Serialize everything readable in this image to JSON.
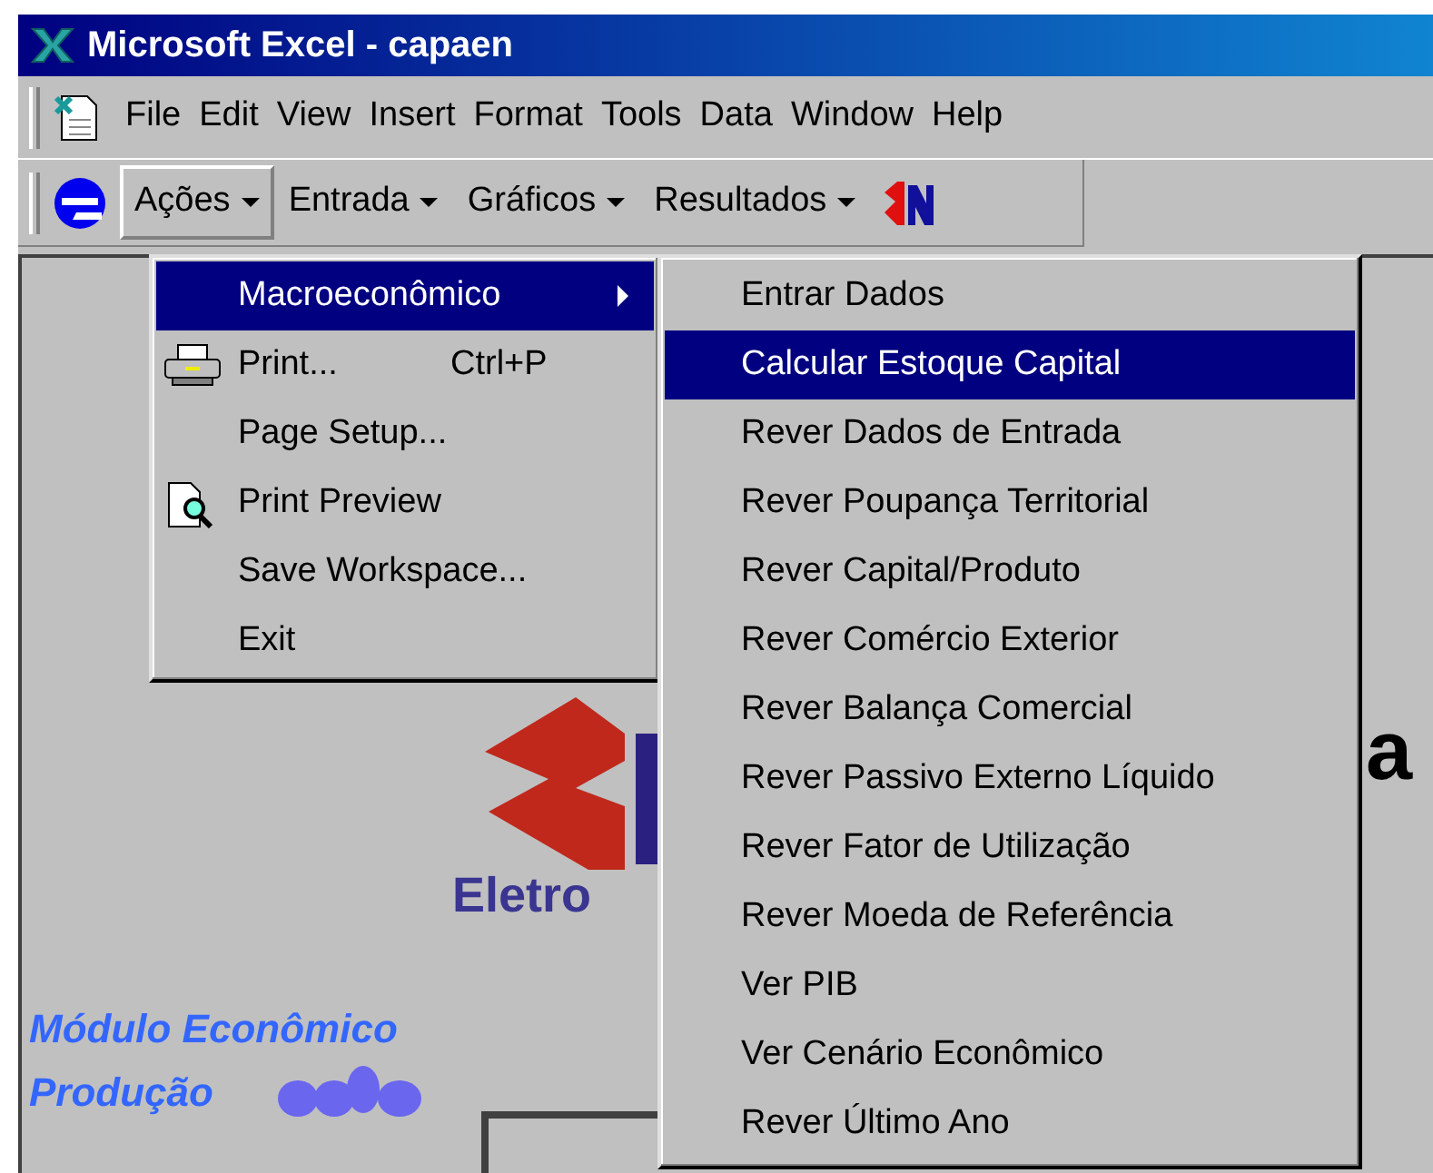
{
  "window": {
    "title": "Microsoft Excel - capaen"
  },
  "menu_bar": [
    {
      "label": "File"
    },
    {
      "label": "Edit"
    },
    {
      "label": "View"
    },
    {
      "label": "Insert"
    },
    {
      "label": "Format"
    },
    {
      "label": "Tools"
    },
    {
      "label": "Data"
    },
    {
      "label": "Window"
    },
    {
      "label": "Help"
    }
  ],
  "toolbar": [
    {
      "label": "Ações",
      "selected": true
    },
    {
      "label": "Entrada",
      "selected": false
    },
    {
      "label": "Gráficos",
      "selected": false
    },
    {
      "label": "Resultados",
      "selected": false
    }
  ],
  "menu": {
    "items": [
      {
        "kind": "submenu",
        "label": "Macroeconômico",
        "selected": true
      },
      {
        "kind": "print",
        "label": "Print...",
        "shortcut": "Ctrl+P",
        "selected": false
      },
      {
        "kind": "command",
        "label": "Page Setup...",
        "selected": false
      },
      {
        "kind": "preview",
        "label": "Print Preview",
        "selected": false
      },
      {
        "kind": "command",
        "label": "Save Workspace...",
        "selected": false
      },
      {
        "kind": "command",
        "label": "Exit",
        "selected": false
      }
    ]
  },
  "submenu": {
    "items": [
      {
        "label": "Entrar Dados",
        "selected": false
      },
      {
        "label": "Calcular Estoque Capital",
        "selected": true
      },
      {
        "label": "Rever Dados de Entrada",
        "selected": false
      },
      {
        "label": "Rever Poupança Territorial",
        "selected": false
      },
      {
        "label": "Rever Capital/Produto",
        "selected": false
      },
      {
        "label": "Rever Comércio Exterior",
        "selected": false
      },
      {
        "label": "Rever Balança Comercial",
        "selected": false
      },
      {
        "label": "Rever Passivo Externo Líquido",
        "selected": false
      },
      {
        "label": "Rever Fator de Utilização",
        "selected": false
      },
      {
        "label": "Rever Moeda de Referência",
        "selected": false
      },
      {
        "label": "Ver PIB",
        "selected": false
      },
      {
        "label": "Ver Cenário Econômico",
        "selected": false
      },
      {
        "label": "Rever Último Ano",
        "selected": false
      }
    ]
  },
  "sheet": {
    "logo_caption": "Eletro",
    "heading_fragment": "a",
    "module_lines": [
      "Módulo Econômico",
      "Produção"
    ]
  }
}
